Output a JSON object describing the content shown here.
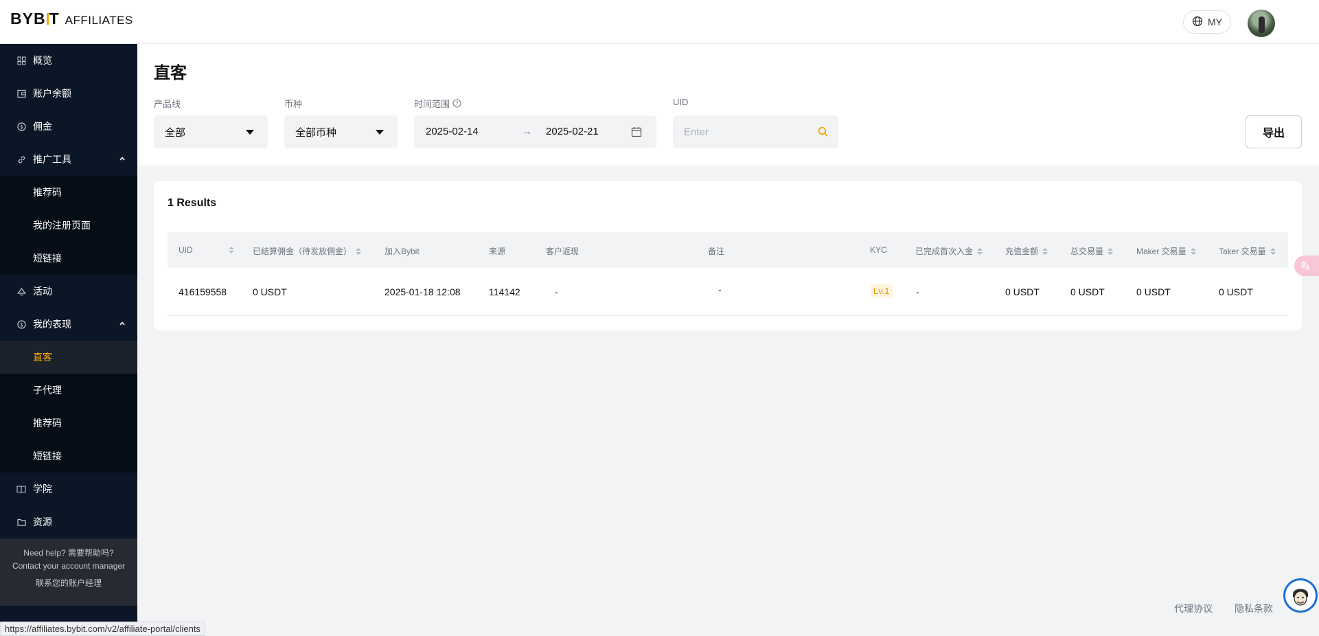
{
  "header": {
    "logo_brand": "BYBIT",
    "logo_sub": "AFFILIATES",
    "lang_label": "MY"
  },
  "sidebar": {
    "items": [
      {
        "label": "概览"
      },
      {
        "label": "账户余额"
      },
      {
        "label": "佣金"
      },
      {
        "label": "推广工具",
        "children": [
          {
            "label": "推荐码"
          },
          {
            "label": "我的注册页面"
          },
          {
            "label": "短链接"
          }
        ]
      },
      {
        "label": "活动"
      },
      {
        "label": "我的表现",
        "children": [
          {
            "label": "直客",
            "active": true
          },
          {
            "label": "子代理"
          },
          {
            "label": "推荐码"
          },
          {
            "label": "短链接"
          }
        ]
      },
      {
        "label": "学院"
      },
      {
        "label": "资源"
      }
    ],
    "help": {
      "line1": "Need help? 需要帮助吗?",
      "line2": "Contact your account manager",
      "line3": "联系您的账户经理"
    }
  },
  "page": {
    "title": "直客"
  },
  "filters": {
    "product_label": "产品线",
    "product_value": "全部",
    "coin_label": "币种",
    "coin_value": "全部币种",
    "range_label": "时间范围",
    "date_start": "2025-02-14",
    "date_sep": "→",
    "date_end": "2025-02-21",
    "uid_label": "UID",
    "uid_placeholder": "Enter",
    "export_label": "导出"
  },
  "results": {
    "count_text": "1 Results",
    "columns": [
      "UID",
      "已结算佣金（待发放佣金）",
      "加入Bybit",
      "来源",
      "客户返现",
      "备注",
      "KYC",
      "已完成首次入金",
      "充值金额",
      "总交易量",
      "Maker 交易量",
      "Taker 交易量"
    ],
    "rows": [
      {
        "uid": "416159558",
        "commission": "0 USDT",
        "joined": "2025-01-18 12:08",
        "source": "114142",
        "cashback": "-",
        "note": "-",
        "kyc": "Lv.1",
        "first_deposit": "-",
        "deposit_amount": "0 USDT",
        "total_volume": "0 USDT",
        "maker_volume": "0 USDT",
        "taker_volume": "0 USDT"
      }
    ]
  },
  "footer": {
    "agent_agreement": "代理协议",
    "privacy": "隐私条款"
  },
  "status_bar": {
    "url": "https://affiliates.bybit.com/v2/affiliate-portal/clients"
  },
  "colors": {
    "accent": "#f7a600",
    "sidebar_bg": "#0b1726",
    "page_bg": "#f2f3f5"
  }
}
